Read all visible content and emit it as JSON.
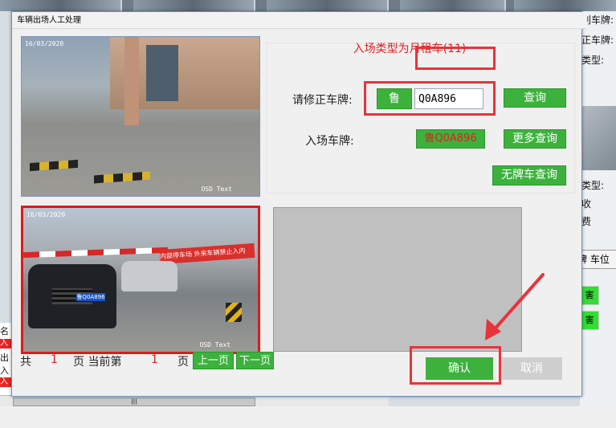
{
  "dialog": {
    "title": "车辆出场人工处理",
    "entry_type": "入场类型为月租车(11)"
  },
  "correct_plate": {
    "label": "请修正车牌:",
    "province_button": "鲁",
    "plate_value": "Q0A896",
    "query_button": "查询"
  },
  "entry_plate": {
    "label": "入场车牌:",
    "value": "鲁Q0A896",
    "more_query_button": "更多查询"
  },
  "no_plate_query_button": "无牌车查询",
  "pager": {
    "total_prefix": "共",
    "total_pages": "1",
    "page_current_label": "页 当前第",
    "current_page": "1",
    "page_suffix": "页",
    "prev_button": "上一页",
    "next_button": "下一页"
  },
  "actions": {
    "confirm": "确认",
    "cancel": "取消"
  },
  "cameras": {
    "top": {
      "timestamp": "16/03/2020",
      "osd": "OSD Text"
    },
    "bottom": {
      "timestamp": "16/03/2020",
      "osd": "OSD Text",
      "plate": "鲁Q0A896",
      "banner": "内部停车场 外来车辆禁止入内"
    }
  },
  "background": {
    "right_texts": [
      "别车牌:",
      "正车牌:",
      "类型:",
      "类型:",
      "收",
      "费"
    ],
    "right_tabs": "牌 车位",
    "right_green": [
      "害",
      "害"
    ],
    "left_texts": [
      "名",
      "入",
      "出",
      "入",
      "入"
    ]
  },
  "colors": {
    "accent_green": "#3cb23c",
    "highlight_red": "#e8333b",
    "entry_text_red": "#e02020"
  }
}
